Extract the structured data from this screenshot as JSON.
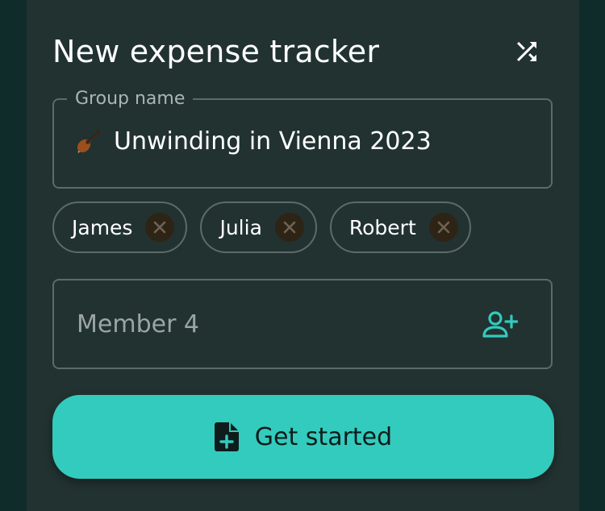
{
  "header": {
    "title": "New expense tracker",
    "shuffle_icon": "shuffle-icon"
  },
  "group": {
    "label": "Group name",
    "emoji_icon": "violin-icon",
    "value": "Unwinding in Vienna 2023"
  },
  "members": [
    {
      "name": "James"
    },
    {
      "name": "Julia"
    },
    {
      "name": "Robert"
    }
  ],
  "new_member": {
    "placeholder": "Member 4",
    "add_icon": "add-person-icon"
  },
  "cta": {
    "label": "Get started",
    "icon": "new-file-icon"
  },
  "colors": {
    "background": "#0f2c2a",
    "card": "#213230",
    "accent": "#33cbbd",
    "border": "#5c6b69",
    "chip_remove_bg": "#2e2416"
  }
}
